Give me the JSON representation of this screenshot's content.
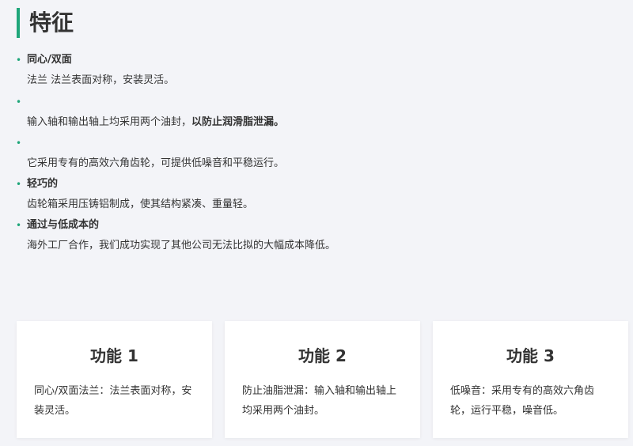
{
  "section": {
    "title": "特征"
  },
  "features": [
    {
      "title": "同心/双面",
      "desc": "法兰 法兰表面对称，安装灵活。"
    },
    {
      "title": "",
      "desc_plain": "输入轴和输出轴上均采用两个油封，",
      "desc_bold": "以防止润滑脂泄漏。"
    },
    {
      "title": "",
      "desc": "它采用专有的高效六角齿轮，可提供低噪音和平稳运行。"
    },
    {
      "title": "轻巧的",
      "desc": "齿轮箱采用压铸铝制成，使其结构紧凑、重量轻。"
    },
    {
      "title": "通过与低成本的",
      "desc": "海外工厂合作，我们成功实现了其他公司无法比拟的大幅成本降低。"
    }
  ],
  "cards": [
    {
      "title": "功能 1",
      "desc": "同心/双面法兰：法兰表面对称，安装灵活。"
    },
    {
      "title": "功能 2",
      "desc": "防止油脂泄漏：输入轴和输出轴上均采用两个油封。"
    },
    {
      "title": "功能 3",
      "desc": "低噪音：采用专有的高效六角齿轮，运行平稳，噪音低。"
    }
  ],
  "colors": {
    "accent": "#1fa67a",
    "background": "#f3f4f8",
    "card": "#ffffff",
    "text": "#333333"
  },
  "icons": {
    "bullet": "dot-bullet-icon"
  }
}
